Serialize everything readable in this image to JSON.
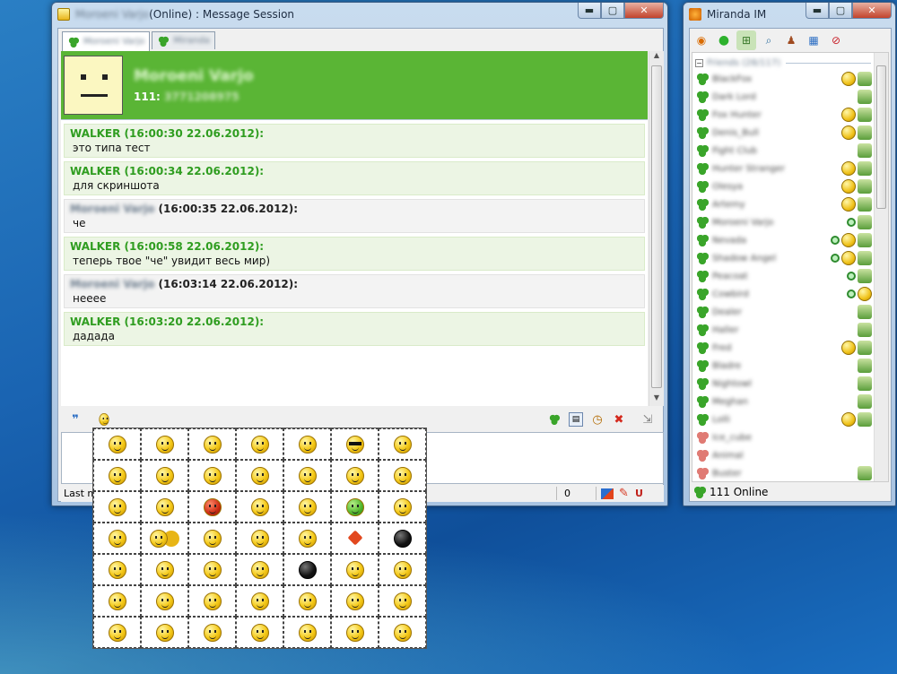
{
  "message_window": {
    "title_contact": "Moroeni Varjo",
    "title_rest": " (Online) : Message Session",
    "tabs": [
      {
        "label": "Moroeni Varjo"
      },
      {
        "label": "Miranda"
      }
    ],
    "header": {
      "contact_name": "Moroeni Varjo",
      "id_label": "111:",
      "id_value": "3771208975"
    },
    "messages": [
      {
        "from": "WALKER",
        "stamp": " (16:00:30 22.06.2012):",
        "text": "это типа тест",
        "self": true
      },
      {
        "from": "WALKER",
        "stamp": " (16:00:34 22.06.2012):",
        "text": "для скриншота",
        "self": true
      },
      {
        "from": "Moroeni Varjo",
        "stamp": " (16:00:35 22.06.2012):",
        "text": "че",
        "self": false
      },
      {
        "from": "WALKER",
        "stamp": " (16:00:58 22.06.2012):",
        "text": "теперь твое \"че\" увидит весь мир)",
        "self": true
      },
      {
        "from": "Moroeni Varjo",
        "stamp": " (16:03:14 22.06.2012):",
        "text": "неeee",
        "self": false
      },
      {
        "from": "WALKER",
        "stamp": " (16:03:20 22.06.2012):",
        "text": "дадада",
        "self": true
      }
    ],
    "status": {
      "last_message": "Last m",
      "char_count": "0"
    },
    "smiley_panel": {
      "rows": 7,
      "cols": 7
    }
  },
  "miranda": {
    "title": "Miranda IM",
    "group_name": "Friends (28/117)",
    "contacts": [
      {
        "name": "BlackFox",
        "icons": [
          "y",
          "m"
        ]
      },
      {
        "name": "Dark Lord",
        "icons": [
          "m"
        ]
      },
      {
        "name": "Fox Hunter",
        "icons": [
          "y",
          "m"
        ]
      },
      {
        "name": "Denis_Bull",
        "icons": [
          "y",
          "m"
        ]
      },
      {
        "name": "Fight Club",
        "icons": [
          "m"
        ]
      },
      {
        "name": "Hunter Stranger",
        "icons": [
          "y",
          "m"
        ]
      },
      {
        "name": "Olesya",
        "icons": [
          "y",
          "m"
        ]
      },
      {
        "name": "Artemy",
        "icons": [
          "y",
          "m"
        ]
      },
      {
        "name": "Moroeni Varjo",
        "icons": [
          "g",
          "m"
        ]
      },
      {
        "name": "Nevada",
        "icons": [
          "g",
          "y",
          "m"
        ]
      },
      {
        "name": "Shadow Angel",
        "icons": [
          "g",
          "y",
          "m"
        ]
      },
      {
        "name": "Peacoat",
        "icons": [
          "g",
          "m"
        ]
      },
      {
        "name": "Cowbird",
        "icons": [
          "g",
          "y"
        ]
      },
      {
        "name": "Dealer",
        "icons": [
          "m"
        ]
      },
      {
        "name": "Haller",
        "icons": [
          "m"
        ]
      },
      {
        "name": "Fred",
        "icons": [
          "y",
          "m"
        ]
      },
      {
        "name": "Bladre",
        "icons": [
          "m"
        ]
      },
      {
        "name": "Nightowl",
        "icons": [
          "m"
        ]
      },
      {
        "name": "Meghan",
        "icons": [
          "m"
        ]
      },
      {
        "name": "Lolli",
        "icons": [
          "y",
          "m"
        ]
      },
      {
        "name": "Ice_cube",
        "icons": []
      },
      {
        "name": "Animal",
        "icons": []
      },
      {
        "name": "Buster",
        "icons": [
          "m"
        ]
      }
    ],
    "status_text": "111 Online"
  },
  "colors": {
    "own_nick": "#2f9d20",
    "header_bg": "#5ab535",
    "desktop": "#1a64b2"
  }
}
